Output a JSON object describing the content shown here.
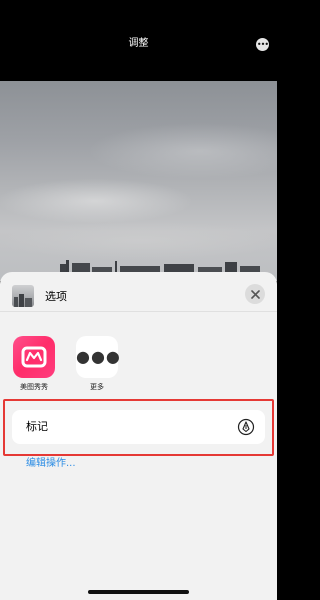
{
  "topbar": {
    "title": "调整",
    "more_icon": "ellipsis-icon"
  },
  "sheet": {
    "title": "选项",
    "close_icon": "close-icon",
    "apps": [
      {
        "label": "美图秀秀",
        "icon": "meitu-app-icon"
      },
      {
        "label": "更多",
        "icon": "more-apps-icon"
      }
    ],
    "action": {
      "label": "标记",
      "icon": "markup-pen-icon"
    },
    "edit_actions_label": "编辑操作...",
    "highlight_color": "#e53935",
    "link_color": "#2b8ce4"
  }
}
